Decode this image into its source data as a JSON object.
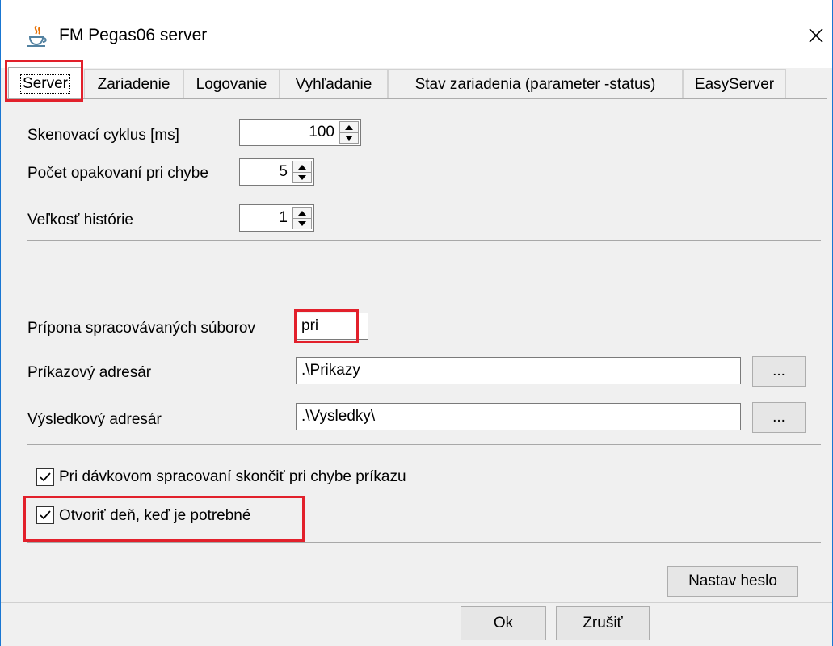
{
  "window": {
    "title": "FM Pegas06 server"
  },
  "tabs": [
    {
      "label": "Server"
    },
    {
      "label": "Zariadenie"
    },
    {
      "label": "Logovanie"
    },
    {
      "label": "Vyhľadanie"
    },
    {
      "label": "Stav zariadenia (parameter -status)"
    },
    {
      "label": "EasyServer"
    }
  ],
  "server": {
    "scan_cycle": {
      "label": "Skenovací cyklus [ms]",
      "value": "100"
    },
    "retries": {
      "label": "Počet opakovaní pri chybe",
      "value": "5"
    },
    "history": {
      "label": "Veľkosť histórie",
      "value": "1"
    },
    "extension": {
      "label": "Prípona spracovávaných súborov",
      "value": "pri"
    },
    "command_dir": {
      "label": "Príkazový adresár",
      "value": ".\\Prikazy",
      "browse": "..."
    },
    "result_dir": {
      "label": "Výsledkový adresár",
      "value": ".\\Vysledky\\",
      "browse": "..."
    },
    "stop_on_error": {
      "label": "Pri dávkovom spracovaní skončiť pri chybe príkazu",
      "checked": true
    },
    "open_day": {
      "label": "Otvoriť deň, keď je potrebné",
      "checked": true
    },
    "set_password": "Nastav heslo"
  },
  "footer": {
    "ok": "Ok",
    "cancel": "Zrušiť"
  },
  "colors": {
    "highlight": "#e2202b",
    "frame": "#1976d2"
  }
}
